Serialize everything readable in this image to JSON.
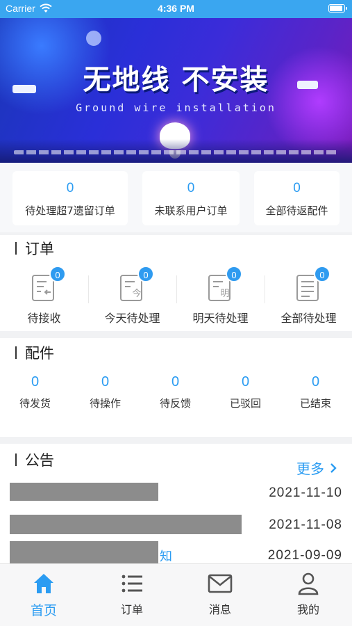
{
  "status_bar": {
    "carrier": "Carrier",
    "time": "4:36 PM"
  },
  "banner": {
    "title": "无地线 不安装",
    "subtitle": "Ground wire installation"
  },
  "stats": [
    {
      "value": "0",
      "label": "待处理超7遗留订单"
    },
    {
      "value": "0",
      "label": "未联系用户订单"
    },
    {
      "value": "0",
      "label": "全部待返配件"
    }
  ],
  "orders": {
    "title": "订单",
    "items": [
      {
        "label": "待接收",
        "badge": "0",
        "glyph": ""
      },
      {
        "label": "今天待处理",
        "badge": "0",
        "glyph": "今"
      },
      {
        "label": "明天待处理",
        "badge": "0",
        "glyph": "明"
      },
      {
        "label": "全部待处理",
        "badge": "0",
        "glyph": ""
      }
    ]
  },
  "parts": {
    "title": "配件",
    "items": [
      {
        "value": "0",
        "label": "待发货"
      },
      {
        "value": "0",
        "label": "待操作"
      },
      {
        "value": "0",
        "label": "待反馈"
      },
      {
        "value": "0",
        "label": "已驳回"
      },
      {
        "value": "0",
        "label": "已结束"
      }
    ]
  },
  "notices": {
    "title": "公告",
    "more": "更多",
    "items": [
      {
        "text_visible": "",
        "date": "2021-11-10"
      },
      {
        "text_visible": "",
        "date": "2021-11-08"
      },
      {
        "text_visible": "知",
        "date": "2021-09-09"
      }
    ]
  },
  "tabbar": {
    "items": [
      {
        "label": "首页",
        "icon": "home-icon",
        "active": true
      },
      {
        "label": "订单",
        "icon": "list-icon",
        "active": false
      },
      {
        "label": "消息",
        "icon": "mail-icon",
        "active": false
      },
      {
        "label": "我的",
        "icon": "user-icon",
        "active": false
      }
    ]
  },
  "colors": {
    "accent": "#2b9cf2",
    "status_bar": "#3aa6f0",
    "redaction": "#8c8c8c"
  }
}
